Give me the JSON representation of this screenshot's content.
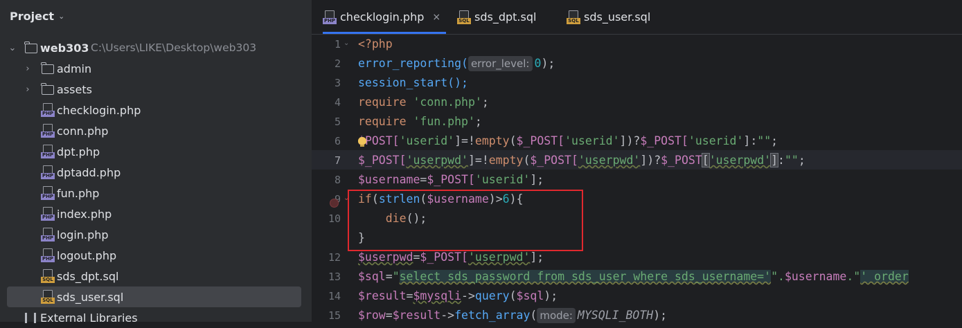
{
  "sidebar": {
    "title": "Project",
    "project": {
      "name": "web303",
      "path": "C:\\Users\\LIKE\\Desktop\\web303"
    },
    "folders": [
      {
        "label": "admin"
      },
      {
        "label": "assets"
      }
    ],
    "files": [
      {
        "label": "checklogin.php",
        "type": "PHP"
      },
      {
        "label": "conn.php",
        "type": "PHP"
      },
      {
        "label": "dpt.php",
        "type": "PHP"
      },
      {
        "label": "dptadd.php",
        "type": "PHP"
      },
      {
        "label": "fun.php",
        "type": "PHP"
      },
      {
        "label": "index.php",
        "type": "PHP"
      },
      {
        "label": "login.php",
        "type": "PHP"
      },
      {
        "label": "logout.php",
        "type": "PHP"
      },
      {
        "label": "sds_dpt.sql",
        "type": "SQL"
      },
      {
        "label": "sds_user.sql",
        "type": "SQL",
        "selected": true
      }
    ],
    "external": "External Libraries"
  },
  "tabs": [
    {
      "label": "checklogin.php",
      "type": "PHP",
      "active": true,
      "close": "×"
    },
    {
      "label": "sds_dpt.sql",
      "type": "SQL"
    },
    {
      "label": "sds_user.sql",
      "type": "SQL"
    }
  ],
  "line_numbers": [
    "1",
    "2",
    "3",
    "4",
    "5",
    "6",
    "7",
    "8",
    "9",
    "10",
    "",
    "12",
    "13",
    "14",
    "15"
  ],
  "code": {
    "l1": "<?php",
    "l2a": "error_reporting(",
    "l2h": "error_level:",
    "l2b": "0",
    "l2c": ");",
    "l3": "session_start();",
    "l4a": "require ",
    "l4b": "'conn.php'",
    "l4c": ";",
    "l5a": "require ",
    "l5b": "'fun.php'",
    "l5c": ";",
    "l6a": "$",
    "l6b": "POST[",
    "l6c": "'userid'",
    "l6d": "]=!",
    "l6e": "empty",
    "l6f": "(",
    "l6g": "$_POST[",
    "l6h": "'userid'",
    "l6i": "])?",
    "l6j": "$_POST[",
    "l6k": "'userid'",
    "l6l": "]:",
    "l6m": "\"\"",
    "l6n": ";",
    "l7a": "$_POST[",
    "l7b": "'userpwd'",
    "l7c": "]=!",
    "l7d": "empty",
    "l7e": "(",
    "l7f": "$_POST[",
    "l7g": "'userpwd'",
    "l7h": "])?",
    "l7i": "$_POST",
    "l7j": "[",
    "l7k": "'userpwd'",
    "l7l": "]",
    "l7m": ":",
    "l7n": "\"\"",
    "l7o": ";",
    "l8a": "$username",
    "l8b": "=",
    "l8c": "$_POST[",
    "l8d": "'userid'",
    "l8e": "];",
    "l9a": "if",
    "l9b": "(",
    "l9c": "strlen",
    "l9d": "(",
    "l9e": "$username",
    "l9f": ")>",
    "l9g": "6",
    "l9h": "){",
    "l10a": "    ",
    "l10b": "die",
    "l10c": "();",
    "l11": "}",
    "l12a": "$userpwd",
    "l12b": "=",
    "l12c": "$_POST[",
    "l12d": "'userpwd'",
    "l12e": "];",
    "l13a": "$sql",
    "l13b": "=",
    "l13c": "\"",
    "l13d": "select sds_password from sds_user where sds_username='",
    "l13e": "\".",
    "l13f": "$username",
    "l13g": ".\"",
    "l13h": "' order",
    "l14a": "$result",
    "l14b": "=",
    "l14c": "$mysqli",
    "l14d": "->",
    "l14e": "query",
    "l14f": "(",
    "l14g": "$sql",
    "l14h": ");",
    "l15a": "$row",
    "l15b": "=",
    "l15c": "$result",
    "l15d": "->",
    "l15e": "fetch_array",
    "l15f": "(",
    "l15h": "mode:",
    "l15i": "MYSQLI_BOTH",
    "l15j": ");"
  },
  "colors": {
    "keyword": "#cf8e6d",
    "function": "#56a8f5",
    "variable": "#c77dbb",
    "string": "#6aab73",
    "number": "#2aacb8",
    "highlight_box": "#e0282e",
    "active_tab": "#3574f0"
  }
}
